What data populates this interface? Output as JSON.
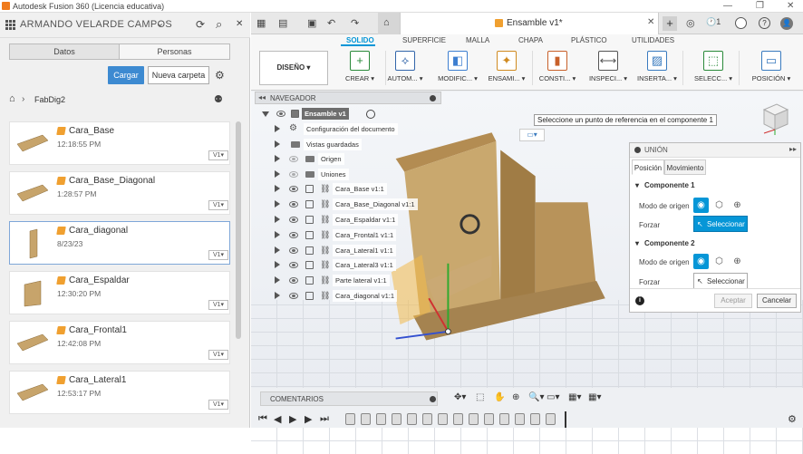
{
  "window": {
    "title": "Autodesk Fusion 360 (Licencia educativa)",
    "minimize": "—",
    "maximize": "❐",
    "close": "✕"
  },
  "left_panel": {
    "user": "ARMANDO VELARDE CAMPOS",
    "user_caret": "⌄",
    "refresh_icon": "⟳",
    "search_icon": "⌕",
    "close_icon": "✕",
    "tabs": {
      "datos": "Datos",
      "personas": "Personas"
    },
    "cargar_label": "Cargar",
    "nueva_carpeta_label": "Nueva carpeta",
    "settings_icon": "⚙",
    "breadcrumb": {
      "home_icon": "⌂",
      "chevron": "›",
      "path": "FabDig2",
      "share_icon": "⚉"
    },
    "files": [
      {
        "name": "Cara_Base",
        "date": "12:18:55 PM",
        "version": "V1▾"
      },
      {
        "name": "Cara_Base_Diagonal",
        "date": "1:28:57 PM",
        "version": "V1▾"
      },
      {
        "name": "Cara_diagonal",
        "date": "8/23/23",
        "version": "V1▾"
      },
      {
        "name": "Cara_Espaldar",
        "date": "12:30:20 PM",
        "version": "V1▾"
      },
      {
        "name": "Cara_Frontal1",
        "date": "12:42:08 PM",
        "version": "V1▾"
      },
      {
        "name": "Cara_Lateral1",
        "date": "12:53:17 PM",
        "version": "V1▾"
      }
    ]
  },
  "doc_tabs": {
    "active": "Ensamble v1*",
    "tab_close": "✕",
    "add_tab": "+",
    "online": "◎",
    "jobs": "🕐1",
    "help": "?",
    "account": "👤"
  },
  "toolbar_glyphs": {
    "grid": "▦",
    "file": "▤",
    "save": "▣",
    "undo": "↶",
    "redo": "↷",
    "home": "⌂"
  },
  "ribbon": {
    "tabs": [
      "SOLIDO",
      "SUPERFICIE",
      "MALLA",
      "CHAPA",
      "PLÁSTICO",
      "UTILIDADES"
    ],
    "workspace": "DISEÑO ▾",
    "groups": [
      {
        "label": "CREAR ▾",
        "color": "#2a8a3a"
      },
      {
        "label": "AUTOM... ▾",
        "color": "#3366aa"
      },
      {
        "label": "MODIFIC... ▾",
        "color": "#3e7fd0"
      },
      {
        "label": "ENSAMI... ▾",
        "color": "#d08a20"
      },
      {
        "label": "CONSTI... ▾",
        "color": "#c8602a"
      },
      {
        "label": "INSPECI... ▾",
        "color": "#555555"
      },
      {
        "label": "INSERTA... ▾",
        "color": "#3a7bbf"
      },
      {
        "label": "SELECC... ▾",
        "color": "#2a8a3a"
      },
      {
        "label": "POSICIÓN ▾",
        "color": "#3a7bbf"
      }
    ]
  },
  "browser": {
    "title": "NAVEGADOR",
    "collapse_icon": "◂◂",
    "root": "Ensamble v1",
    "items": [
      {
        "label": "Configuración del documento",
        "kind": "gear",
        "glyph": "⚙"
      },
      {
        "label": "Vistas guardadas",
        "kind": "folder"
      },
      {
        "label": "Origen",
        "kind": "folder-eye"
      },
      {
        "label": "Uniones",
        "kind": "folder-eye"
      },
      {
        "label": "Cara_Base v1:1",
        "kind": "comp"
      },
      {
        "label": "Cara_Base_Diagonal v1:1",
        "kind": "comp"
      },
      {
        "label": "Cara_Espaldar v1:1",
        "kind": "comp"
      },
      {
        "label": "Cara_Frontal1 v1:1",
        "kind": "comp"
      },
      {
        "label": "Cara_Lateral1 v1:1",
        "kind": "comp"
      },
      {
        "label": "Cara_Lateral3 v1:1",
        "kind": "comp"
      },
      {
        "label": "Parte lateral v1:1",
        "kind": "comp"
      },
      {
        "label": "Cara_diagonal v1:1",
        "kind": "comp"
      }
    ],
    "link_icon": "⛓"
  },
  "tooltip": "Seleccione un punto de referencia en el componente 1",
  "snap_icon": "▭▾",
  "union_dialog": {
    "title": "UNIÓN",
    "expand_icon": "▸▸",
    "tabs": [
      "Posición",
      "Movimiento"
    ],
    "component1": "Componente 1",
    "component2": "Componente 2",
    "modo_origen": "Modo de origen",
    "forzar": "Forzar",
    "seleccionar": "Seleccionar",
    "section_caret": "▾",
    "mode_icons": [
      "◉",
      "⬡",
      "⊕"
    ],
    "cursor_icon": "↖",
    "info_icon": "i",
    "aceptar": "Aceptar",
    "cancelar": "Cancelar"
  },
  "bottom": {
    "comentarios": "COMENTARIOS",
    "nav_tools": [
      "✥▾",
      "⬚",
      "✋",
      "⊕",
      "🔍▾",
      "▭▾",
      "▦▾",
      "▦▾"
    ]
  },
  "timeline": {
    "controls": [
      "⏮",
      "◀",
      "▶",
      "▶",
      "⏭"
    ],
    "steps": 14,
    "settings_icon": "⚙"
  },
  "colors": {
    "accent": "#0696d7",
    "cargar": "#3d8ad1",
    "wood": "#c7a46b"
  }
}
